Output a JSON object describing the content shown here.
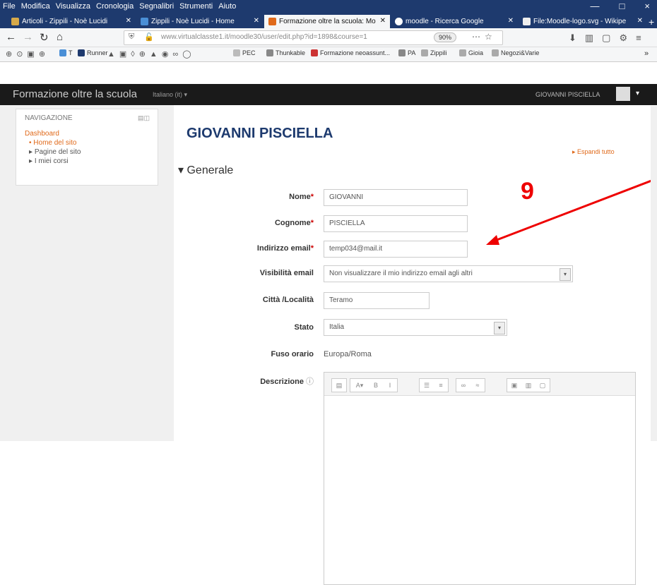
{
  "menubar": {
    "items": [
      "File",
      "Modifica",
      "Visualizza",
      "Cronologia",
      "Segnalibri",
      "Strumenti",
      "Aiuto"
    ],
    "minimize": "—",
    "maximize": "□",
    "close": "×"
  },
  "tabs": [
    {
      "title": "Articoli - Zippili - Noè Lucidi"
    },
    {
      "title": "Zippili - Noè Lucidi - Home"
    },
    {
      "title": "Formazione oltre la scuola: Mo"
    },
    {
      "title": "moodle - Ricerca Google"
    },
    {
      "title": "File:Moodle-logo.svg - Wikipe"
    }
  ],
  "nav": {
    "url": "www.virtualclasste1.it/moodle30/user/edit.php?id=1898&course=1",
    "zoom": "90%"
  },
  "bookmarks": [
    {
      "label": "T"
    },
    {
      "label": "Runner"
    },
    {
      "label": "PEC"
    },
    {
      "label": "Thunkable"
    },
    {
      "label": "Formazione neoassunt..."
    },
    {
      "label": "PA"
    },
    {
      "label": "Zippili"
    },
    {
      "label": "Gioia"
    },
    {
      "label": "Negozi&Varie"
    }
  ],
  "moodle": {
    "brand": "Formazione oltre la scuola",
    "language": "Italiano (it) ▾",
    "user": "GIOVANNI PISCIELLA"
  },
  "navblock": {
    "title": "NAVIGAZIONE",
    "dashboard": "Dashboard",
    "items": [
      "Home del sito",
      "Pagine del sito",
      "I miei corsi"
    ]
  },
  "page": {
    "title": "GIOVANNI PISCIELLA",
    "expand_all": "Espandi tutto",
    "section": "Generale"
  },
  "form": {
    "nome_label": "Nome",
    "nome_value": "GIOVANNI",
    "cognome_label": "Cognome",
    "cognome_value": "PISCIELLA",
    "email_label": "Indirizzo email",
    "email_value": "temp034@mail.it",
    "visibility_label": "Visibilità email",
    "visibility_value": "Non visualizzare il mio indirizzo email agli altri",
    "city_label": "Città /Località",
    "city_value": "Teramo",
    "country_label": "Stato",
    "country_value": "Italia",
    "timezone_label": "Fuso orario",
    "timezone_value": "Europa/Roma",
    "description_label": "Descrizione",
    "required_mark": "*"
  },
  "annotation": {
    "number": "9",
    "color": "#e00000"
  }
}
